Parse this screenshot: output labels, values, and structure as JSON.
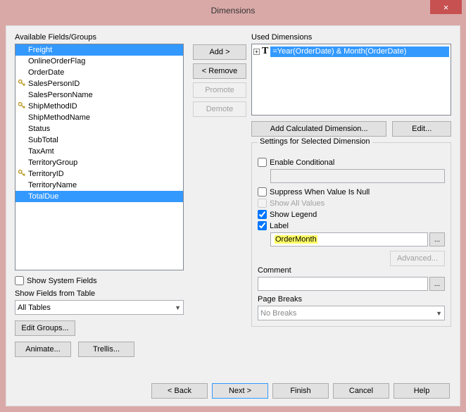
{
  "window": {
    "title": "Dimensions",
    "close": "×"
  },
  "left": {
    "title": "Available Fields/Groups",
    "items": [
      {
        "label": "Freight",
        "selected": true,
        "key": false
      },
      {
        "label": "OnlineOrderFlag",
        "key": false
      },
      {
        "label": "OrderDate",
        "key": false
      },
      {
        "label": "SalesPersonID",
        "key": true
      },
      {
        "label": "SalesPersonName",
        "key": false
      },
      {
        "label": "ShipMethodID",
        "key": true
      },
      {
        "label": "ShipMethodName",
        "key": false
      },
      {
        "label": "Status",
        "key": false
      },
      {
        "label": "SubTotal",
        "key": false
      },
      {
        "label": "TaxAmt",
        "key": false
      },
      {
        "label": "TerritoryGroup",
        "key": false
      },
      {
        "label": "TerritoryID",
        "key": true
      },
      {
        "label": "TerritoryName",
        "key": false
      },
      {
        "label": "TotalDue",
        "selected": true,
        "key": false
      }
    ],
    "show_system": "Show System Fields",
    "show_table_label": "Show Fields from Table",
    "show_table_value": "All Tables",
    "edit_groups": "Edit Groups...",
    "animate": "Animate...",
    "trellis": "Trellis..."
  },
  "mid": {
    "add": "Add >",
    "remove": "< Remove",
    "promote": "Promote",
    "demote": "Demote"
  },
  "right": {
    "used_title": "Used Dimensions",
    "used_expr": "=Year(OrderDate) & Month(OrderDate)",
    "add_calc": "Add Calculated Dimension...",
    "edit": "Edit...",
    "settings_title": "Settings for Selected Dimension",
    "enable_cond": "Enable Conditional",
    "cond_value": "",
    "suppress_null": "Suppress When Value Is Null",
    "show_all": "Show All Values",
    "show_legend": "Show Legend",
    "label_chk": "Label",
    "label_value": "OrderMonth",
    "advanced": "Advanced...",
    "comment": "Comment",
    "comment_value": "",
    "page_breaks": "Page Breaks",
    "page_breaks_value": "No Breaks"
  },
  "footer": {
    "back": "< Back",
    "next": "Next >",
    "finish": "Finish",
    "cancel": "Cancel",
    "help": "Help"
  }
}
